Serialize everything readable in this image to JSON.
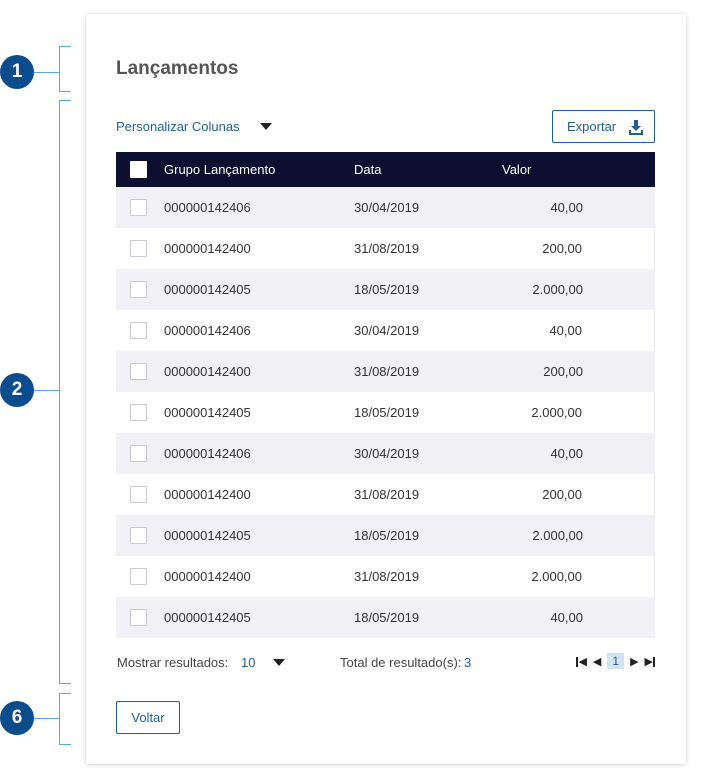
{
  "markers": [
    "1",
    "2",
    "6"
  ],
  "page": {
    "title": "Lançamentos"
  },
  "toolbar": {
    "customize_columns": "Personalizar Colunas",
    "export_label": "Exportar"
  },
  "table": {
    "columns": [
      "Grupo Lançamento",
      "Data",
      "Valor"
    ],
    "rows": [
      {
        "group": "000000142406",
        "date": "30/04/2019",
        "value": "40,00"
      },
      {
        "group": "000000142400",
        "date": "31/08/2019",
        "value": "200,00"
      },
      {
        "group": "000000142405",
        "date": "18/05/2019",
        "value": "2.000,00"
      },
      {
        "group": "000000142406",
        "date": "30/04/2019",
        "value": "40,00"
      },
      {
        "group": "000000142400",
        "date": "31/08/2019",
        "value": "200,00"
      },
      {
        "group": "000000142405",
        "date": "18/05/2019",
        "value": "2.000,00"
      },
      {
        "group": "000000142406",
        "date": "30/04/2019",
        "value": "40,00"
      },
      {
        "group": "000000142400",
        "date": "31/08/2019",
        "value": "200,00"
      },
      {
        "group": "000000142405",
        "date": "18/05/2019",
        "value": "2.000,00"
      },
      {
        "group": "000000142400",
        "date": "31/08/2019",
        "value": "2.000,00"
      },
      {
        "group": "000000142405",
        "date": "18/05/2019",
        "value": "40,00"
      }
    ]
  },
  "footer": {
    "show_results_label": "Mostrar resultados:",
    "show_results_value": "10",
    "total_label": "Total de resultado(s):",
    "total_value": "3",
    "current_page": "1"
  },
  "actions": {
    "back_label": "Voltar"
  },
  "colors": {
    "accent": "#1f5f95",
    "marker": "#0b4d8c",
    "header_bg": "#0c0f2f",
    "stripe": "#f0f0f5"
  },
  "icons": [
    "download-icon",
    "first-page-icon",
    "prev-page-icon",
    "next-page-icon",
    "last-page-icon",
    "caret-down-icon"
  ]
}
